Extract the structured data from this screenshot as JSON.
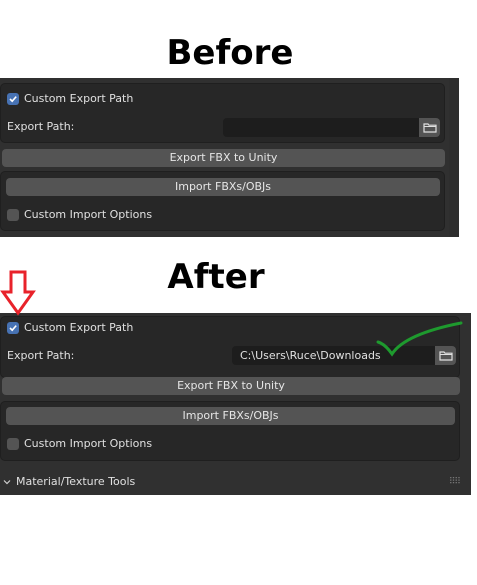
{
  "before": {
    "heading": "Before",
    "custom_export_path": {
      "label": "Custom Export Path",
      "checked": true
    },
    "export_path": {
      "label": "Export Path:",
      "value": "",
      "icon": "folder-icon"
    },
    "export_fbx_button": "Export FBX to Unity",
    "import_button": "Import FBXs/OBJs",
    "custom_import_options": {
      "label": "Custom Import Options",
      "checked": false
    }
  },
  "after": {
    "heading": "After",
    "custom_export_path": {
      "label": "Custom Export Path",
      "checked": true
    },
    "export_path": {
      "label": "Export Path:",
      "value": "C:\\Users\\Ruce\\Downloads",
      "icon": "folder-icon"
    },
    "export_fbx_button": "Export FBX to Unity",
    "import_button": "Import FBXs/OBJs",
    "custom_import_options": {
      "label": "Custom Import Options",
      "checked": false
    },
    "material_section": {
      "label": "Material/Texture Tools",
      "icon": "chevron-down-icon"
    }
  },
  "annotations": {
    "arrow_color": "#e8222a",
    "checkmark_color": "#1e9a2e"
  }
}
